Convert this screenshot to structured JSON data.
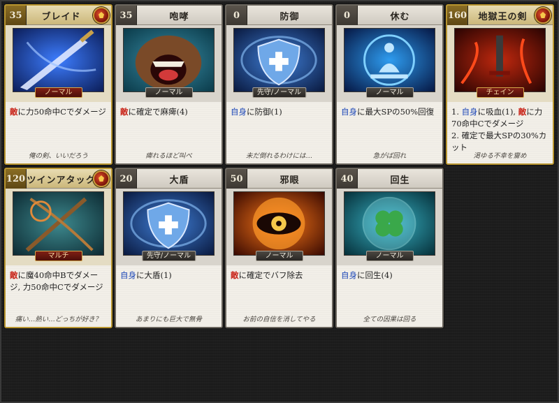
{
  "cards": [
    {
      "cost": "35",
      "title": "ブレイド",
      "type": "ノーマル",
      "gold": true,
      "desc": [
        {
          "t": "敵",
          "c": "red"
        },
        {
          "t": "に力50命中Cでダメージ",
          "c": ""
        }
      ],
      "flavor": "俺の剣、いいだろう",
      "art": "sword-art",
      "colors": {
        "bg1": "#0c1e5a",
        "bg2": "#3d7dff"
      }
    },
    {
      "cost": "35",
      "title": "咆哮",
      "type": "ノーマル",
      "gold": false,
      "desc": [
        {
          "t": "敵",
          "c": "red"
        },
        {
          "t": "に確定で麻痺(4)",
          "c": ""
        }
      ],
      "flavor": "痺れるほど叫べ",
      "art": "roaring-beast-art",
      "colors": {
        "bg1": "#0b3b4a",
        "bg2": "#3a8fa8"
      }
    },
    {
      "cost": "0",
      "title": "防御",
      "type": "先守/ノーマル",
      "gold": false,
      "desc": [
        {
          "t": "自身",
          "c": "blue"
        },
        {
          "t": "に防御(1)",
          "c": ""
        }
      ],
      "flavor": "未だ倒れるわけには…",
      "art": "shield-art",
      "colors": {
        "bg1": "#0a1a40",
        "bg2": "#3f7ed6"
      }
    },
    {
      "cost": "0",
      "title": "休む",
      "type": "ノーマル",
      "gold": false,
      "desc": [
        {
          "t": "自身",
          "c": "blue"
        },
        {
          "t": "に最大SPの50%回復",
          "c": ""
        }
      ],
      "flavor": "急がば回れ",
      "art": "meditation-art",
      "colors": {
        "bg1": "#061845",
        "bg2": "#2e9cf0"
      }
    },
    {
      "cost": "160",
      "title": "地獄王の剣",
      "type": "チェイン",
      "gold": true,
      "desc": [
        {
          "t": "1. ",
          "c": ""
        },
        {
          "t": "自身",
          "c": "blue"
        },
        {
          "t": "に吸血(1), ",
          "c": ""
        },
        {
          "t": "敵",
          "c": "red"
        },
        {
          "t": "に力70命中Cでダメージ",
          "c": ""
        },
        {
          "t": "\n2. 確定で最大SPの30%カット",
          "c": ""
        }
      ],
      "flavor": "渇ゆる不幸を齎め",
      "art": "hell-sword-art",
      "colors": {
        "bg1": "#2a0402",
        "bg2": "#c0280e"
      }
    },
    {
      "cost": "120",
      "title": "ツインアタック",
      "type": "マルチ",
      "gold": true,
      "desc": [
        {
          "t": "敵",
          "c": "red"
        },
        {
          "t": "に魔40命中Bでダメージ, 力50命中Cでダメージ",
          "c": ""
        }
      ],
      "flavor": "痛い…熱い…どっちが好き？",
      "art": "twin-staff-art",
      "colors": {
        "bg1": "#0d2b33",
        "bg2": "#3e8a8f"
      }
    },
    {
      "cost": "20",
      "title": "大盾",
      "type": "先守/ノーマル",
      "gold": false,
      "desc": [
        {
          "t": "自身",
          "c": "blue"
        },
        {
          "t": "に大盾(1)",
          "c": ""
        }
      ],
      "flavor": "あまりにも巨大で無骨",
      "art": "big-shield-art",
      "colors": {
        "bg1": "#0a1a40",
        "bg2": "#3f7ed6"
      }
    },
    {
      "cost": "50",
      "title": "邪眼",
      "type": "ノーマル",
      "gold": false,
      "desc": [
        {
          "t": "敵",
          "c": "red"
        },
        {
          "t": "に確定でバフ除去",
          "c": ""
        }
      ],
      "flavor": "お前の自信を消してやる",
      "art": "evil-eye-art",
      "colors": {
        "bg1": "#3a0a02",
        "bg2": "#ff7a18"
      }
    },
    {
      "cost": "40",
      "title": "回生",
      "type": "ノーマル",
      "gold": false,
      "desc": [
        {
          "t": "自身",
          "c": "blue"
        },
        {
          "t": "に回生(4)",
          "c": ""
        }
      ],
      "flavor": "全ての因果は回る",
      "art": "clover-orb-art",
      "colors": {
        "bg1": "#06303a",
        "bg2": "#39b6c8"
      }
    }
  ]
}
